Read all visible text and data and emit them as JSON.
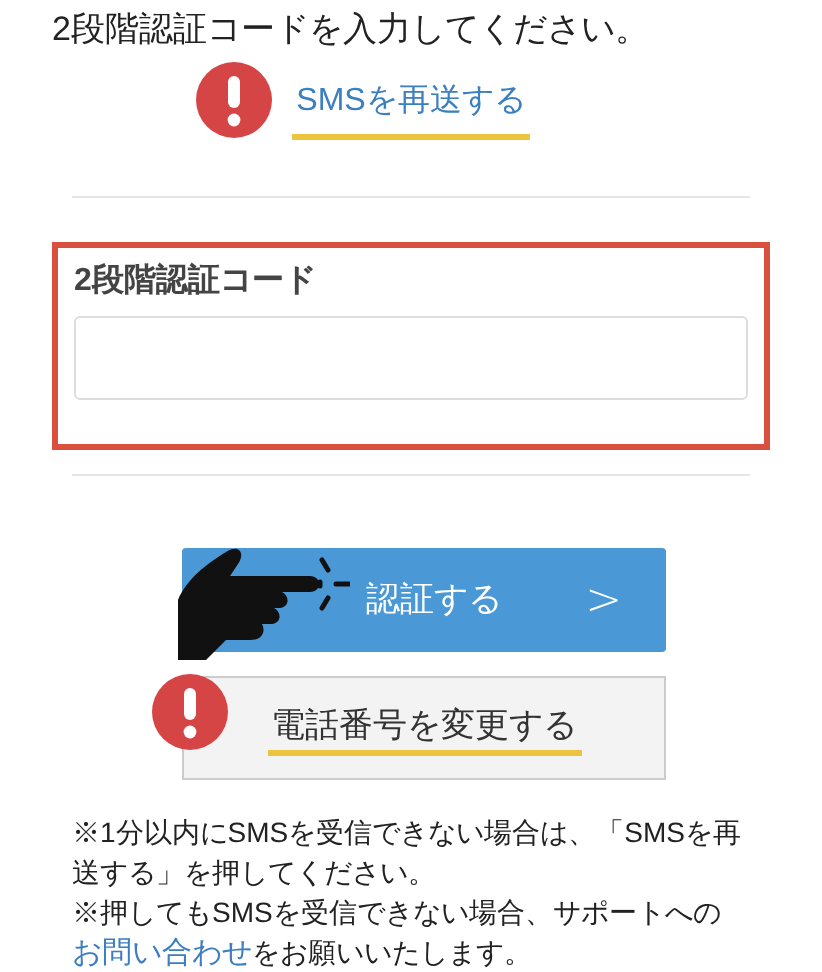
{
  "instruction": "2段階認証コードを入力してください。",
  "resend_link": "SMSを再送する",
  "code_field": {
    "label": "2段階認証コード"
  },
  "verify_button": {
    "label": "認証する",
    "chevron": ">"
  },
  "change_phone_button": "電話番号を変更する",
  "notes": [
    {
      "text": "※1分以内にSMSを受信できない場合は、「SMSを再送する」を押してください。"
    },
    {
      "text": "※押してもSMSを受信できない場合、サポートへの",
      "link": "お問い合わせ",
      "after": "をお願いいたします。"
    }
  ]
}
